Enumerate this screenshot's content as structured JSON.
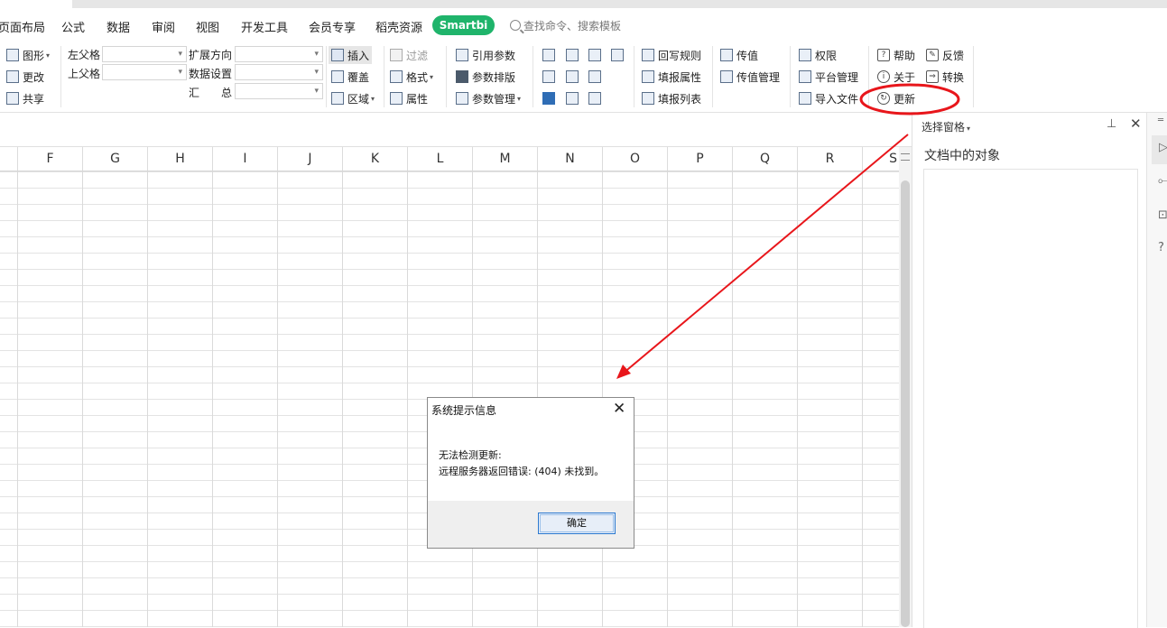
{
  "menu": {
    "items": [
      "页面布局",
      "公式",
      "数据",
      "审阅",
      "视图",
      "开发工具",
      "会员专享",
      "稻壳资源"
    ],
    "smartbi_tab": "Smartbi",
    "search_placeholder": "查找命令、搜索模板"
  },
  "ribbon": {
    "group1": [
      "图形",
      "更改",
      "共享"
    ],
    "parent": {
      "left_label": "左父格",
      "top_label": "上父格",
      "expand_label": "扩展方向",
      "dataset_label": "数据设置",
      "summary_label": "汇　　总"
    },
    "insert": [
      "插入",
      "覆盖",
      "区域"
    ],
    "filter": [
      "过滤",
      "格式",
      "属性"
    ],
    "params": [
      "引用参数",
      "参数排版",
      "参数管理"
    ],
    "writeback": [
      "回写规则",
      "填报属性",
      "填报列表"
    ],
    "passvalue": [
      "传值",
      "传值管理"
    ],
    "platform": [
      "权限",
      "平台管理",
      "导入文件"
    ],
    "help": [
      "帮助",
      "关于",
      "更新"
    ],
    "feedback": [
      "反馈",
      "转换"
    ]
  },
  "grid": {
    "columns": [
      "F",
      "G",
      "H",
      "I",
      "J",
      "K",
      "L",
      "M",
      "N",
      "O",
      "P",
      "Q",
      "R",
      "S"
    ]
  },
  "panel": {
    "title": "选择窗格",
    "subtitle": "文档中的对象"
  },
  "dialog": {
    "title": "系统提示信息",
    "line1": "无法检测更新:",
    "line2": "远程服务器返回错误: (404) 未找到。",
    "ok_label": "确定"
  },
  "colors": {
    "smartbi_green": "#1fb46b",
    "annotation_red": "#e8161b",
    "ok_border": "#2a78d0"
  }
}
